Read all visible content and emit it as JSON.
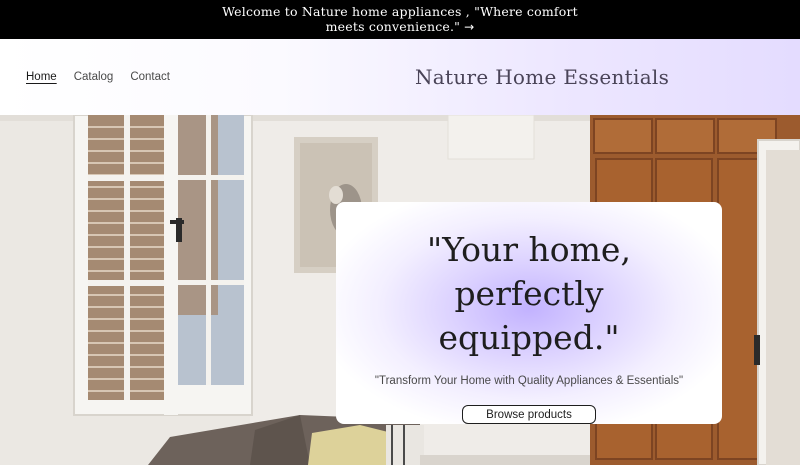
{
  "announcement": {
    "text": "Welcome to Nature home appliances , \"Where comfort meets convenience.\"",
    "arrow": "→"
  },
  "header": {
    "nav": [
      {
        "label": "Home",
        "active": true
      },
      {
        "label": "Catalog",
        "active": false
      },
      {
        "label": "Contact",
        "active": false
      }
    ],
    "brand": "Nature Home Essentials"
  },
  "hero": {
    "heading": "\"Your home, perfectly equipped.\"",
    "subheading": "\"Transform Your Home with Quality Appliances & Essentials\"",
    "button_label": "Browse products"
  },
  "colors": {
    "announcement_bg": "#000000",
    "accent_lavender": "#c2b2ff",
    "text_dark": "#1e1e1e"
  }
}
